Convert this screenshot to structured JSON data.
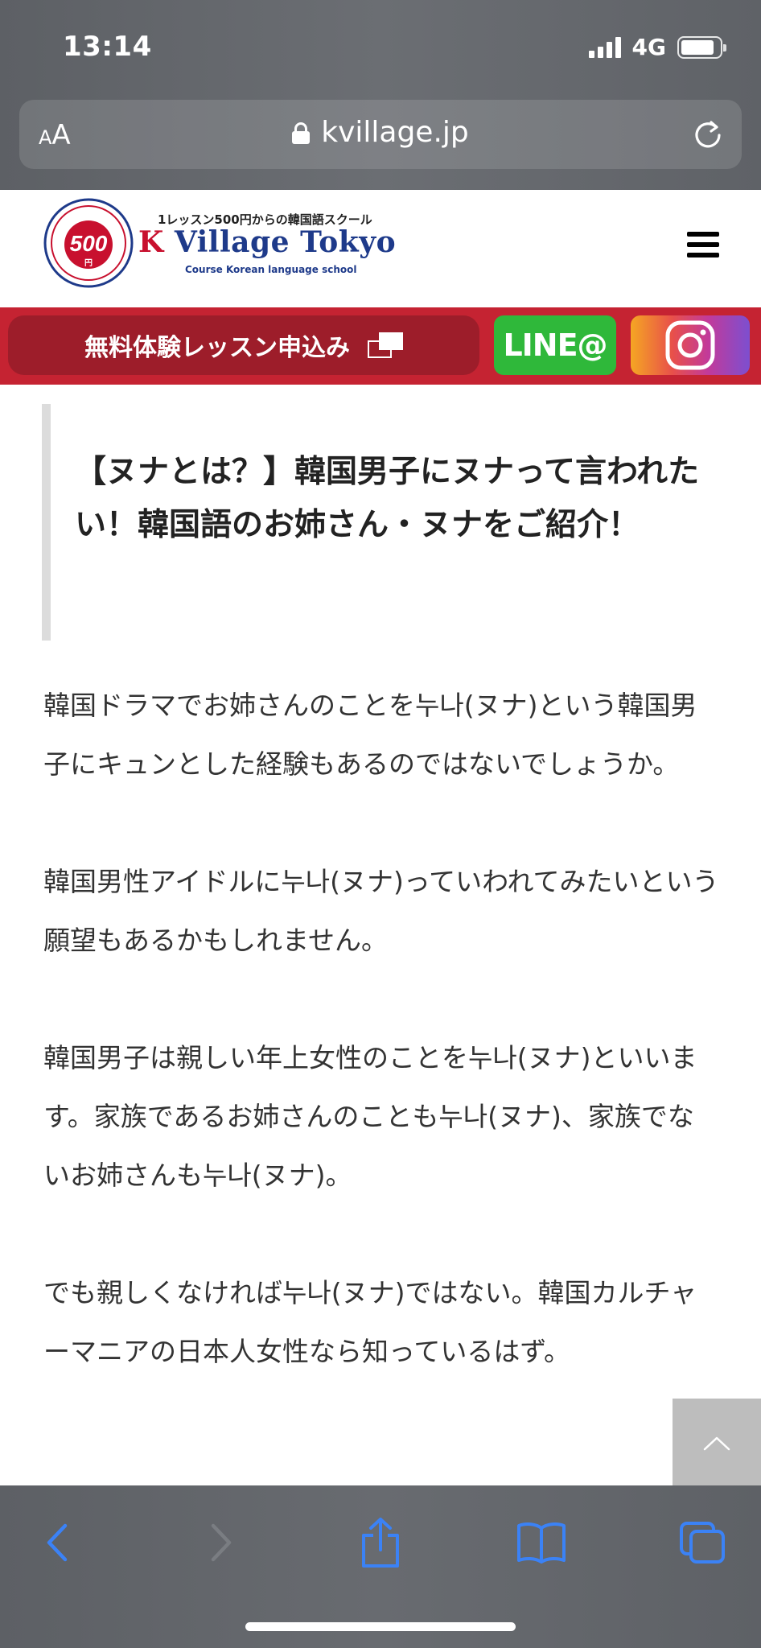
{
  "status_bar": {
    "time": "13:14",
    "network": "4G"
  },
  "browser": {
    "aa_label_small": "A",
    "aa_label_large": "A",
    "url": "kvillage.jp"
  },
  "site": {
    "tagline": "1レッスン500円からの韓国語スクール",
    "name_k": "K",
    "name_rest": " Village Tokyo",
    "subtitle": "Course Korean language school"
  },
  "cta": {
    "trial_label": "無料体験レッスン申込み",
    "line_label": "LINE@"
  },
  "article": {
    "title": "【ヌナとは？】韓国男子にヌナって言われたい！韓国語のお姉さん・ヌナをご紹介！",
    "paragraphs": [
      "韓国ドラマでお姉さんのことを누나(ヌナ)という韓国男子にキュンとした経験もあるのではないでしょうか。",
      "韓国男性アイドルに누나(ヌナ)っていわれてみたいという願望もあるかもしれません。",
      "韓国男子は親しい年上女性のことを누나(ヌナ)といいます。家族であるお姉さんのことも누나(ヌナ)、家族でないお姉さんも누나(ヌナ)。",
      "でも親しくなければ누나(ヌナ)ではない。韓国カルチャーマニアの日本人女性なら知っているはず。"
    ]
  },
  "colors": {
    "brand_red": "#c52332",
    "line_green": "#2fb83a",
    "toolbar_icon_blue": "#3b82f6"
  },
  "icons": {
    "lock": "lock-icon",
    "reload": "reload-icon",
    "menu": "hamburger-icon",
    "external": "external-window-icon",
    "instagram": "instagram-icon",
    "scroll_top": "chevron-up-icon",
    "back": "chevron-left-icon",
    "forward": "chevron-right-icon",
    "share": "share-icon",
    "bookmarks": "book-icon",
    "tabs": "tabs-icon"
  }
}
